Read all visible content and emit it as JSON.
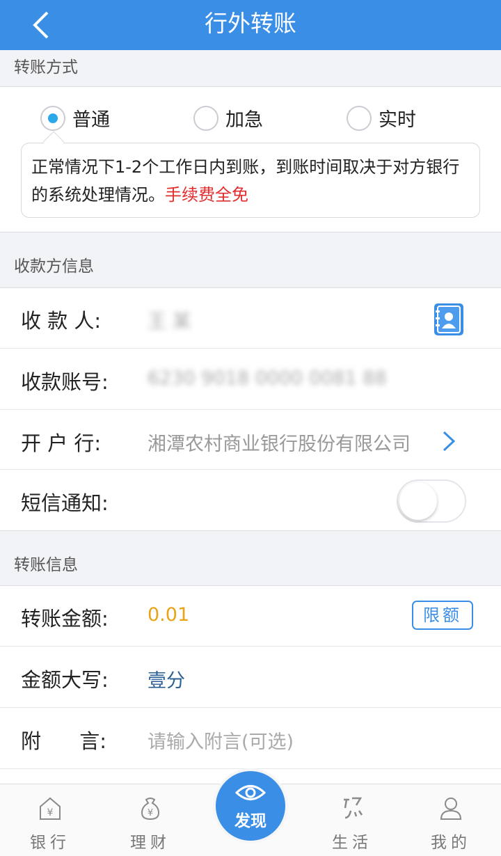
{
  "header": {
    "title": "行外转账"
  },
  "transfer_method": {
    "section_title": "转账方式",
    "options": [
      {
        "label": "普通",
        "selected": true
      },
      {
        "label": "加急",
        "selected": false
      },
      {
        "label": "实时",
        "selected": false
      }
    ],
    "tip_text": "正常情况下1-2个工作日内到账，到账时间取决于对方银行的系统处理情况。",
    "tip_highlight": "手续费全免"
  },
  "payee": {
    "section_title": "收款方信息",
    "name_label": "收 款 人:",
    "name_value": "王 某",
    "account_label": "收款账号:",
    "account_value": "6230 9018 0000 0081 88",
    "bank_label": "开 户 行:",
    "bank_value": "湘潭农村商业银行股份有限公司",
    "sms_label": "短信通知:",
    "sms_enabled": false
  },
  "transfer_info": {
    "section_title": "转账信息",
    "amount_label": "转账金额:",
    "amount_value": "0.01",
    "limit_button": "限额",
    "uppercase_label": "金额大写:",
    "uppercase_value": "壹分",
    "remark_label": "附      言:",
    "remark_placeholder": "请输入附言(可选)"
  },
  "tabbar": {
    "tabs": [
      {
        "label": "银行",
        "icon": "bank-icon"
      },
      {
        "label": "理财",
        "icon": "wealth-icon"
      },
      {
        "label": "发现",
        "icon": "eye-icon"
      },
      {
        "label": "生活",
        "icon": "life-icon"
      },
      {
        "label": "我的",
        "icon": "profile-icon"
      }
    ]
  },
  "colors": {
    "primary": "#3a8ee6",
    "radio_checked": "#2aa8ea",
    "amount": "#e8a317",
    "highlight_red": "#e22d2d"
  }
}
